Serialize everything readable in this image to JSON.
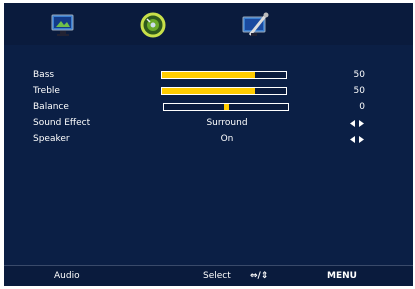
{
  "icons": [
    "tv-picture-icon",
    "audio-disc-icon",
    "settings-tools-icon"
  ],
  "rows": [
    {
      "label": "Bass",
      "value": "50",
      "level": 0.75
    },
    {
      "label": "Treble",
      "value": "50",
      "level": 0.75
    },
    {
      "label": "Balance",
      "value": "0",
      "level": 0.5
    },
    {
      "label": "Sound Effect",
      "option": "Surround"
    },
    {
      "label": "Speaker",
      "option": "On"
    }
  ],
  "footer": {
    "menu_name": "Audio",
    "select_label": "Select",
    "nav_hint": "⇔/⇕",
    "menu_label": "MENU"
  },
  "colors": {
    "background": "#0b1f45",
    "slider_fill": "#ffcc00",
    "text": "#ffffff"
  }
}
